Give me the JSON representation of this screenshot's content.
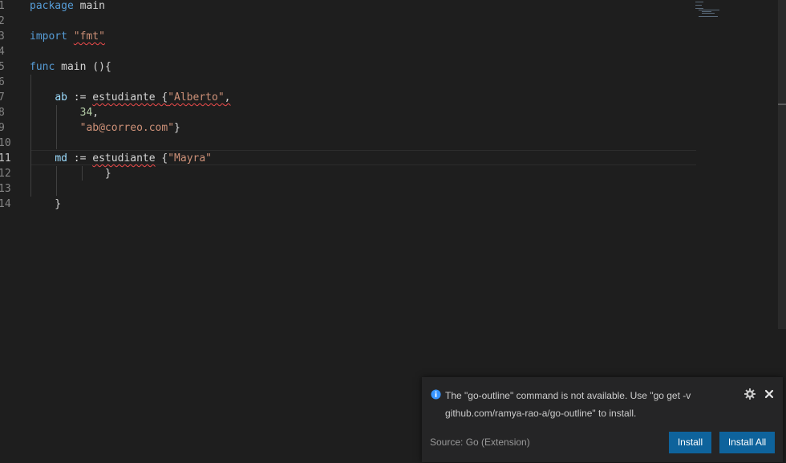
{
  "editor": {
    "line_numbers": [
      "1",
      "2",
      "3",
      "4",
      "5",
      "6",
      "7",
      "8",
      "9",
      "10",
      "11",
      "12",
      "13",
      "14"
    ],
    "current_line": "11",
    "lines": [
      [
        {
          "t": "package",
          "c": "kw"
        },
        {
          "t": " main",
          "c": "pl"
        }
      ],
      [],
      [
        {
          "t": "import",
          "c": "kw"
        },
        {
          "t": " ",
          "c": "pl"
        },
        {
          "t": "\"fmt\"",
          "c": "str",
          "err": true
        }
      ],
      [],
      [
        {
          "t": "func",
          "c": "kw"
        },
        {
          "t": " main ()",
          "c": "pl"
        },
        {
          "t": "{",
          "c": "pl"
        }
      ],
      [],
      [
        {
          "t": "    ",
          "c": "pl"
        },
        {
          "t": "ab",
          "c": "id"
        },
        {
          "t": " := ",
          "c": "pl"
        },
        {
          "t": "estudiante {",
          "c": "pl",
          "err": true
        },
        {
          "t": "\"Alberto\"",
          "c": "str",
          "err": true
        },
        {
          "t": ",",
          "c": "pl",
          "err": true
        }
      ],
      [
        {
          "t": "        ",
          "c": "pl"
        },
        {
          "t": "34",
          "c": "num"
        },
        {
          "t": ",",
          "c": "pl"
        }
      ],
      [
        {
          "t": "        ",
          "c": "pl"
        },
        {
          "t": "\"ab@correo.com\"",
          "c": "str"
        },
        {
          "t": "}",
          "c": "pl"
        }
      ],
      [],
      [
        {
          "t": "    ",
          "c": "pl"
        },
        {
          "t": "md",
          "c": "id"
        },
        {
          "t": " := ",
          "c": "pl"
        },
        {
          "t": "estudiante",
          "c": "pl",
          "err": true
        },
        {
          "t": " {",
          "c": "pl"
        },
        {
          "t": "\"Mayra\"",
          "c": "str"
        }
      ],
      [
        {
          "t": "            }",
          "c": "pl"
        }
      ],
      [],
      [
        {
          "t": "    }",
          "c": "pl"
        }
      ]
    ]
  },
  "notification": {
    "icon": "info-icon",
    "message": "The \"go-outline\" command is not available. Use \"go get -v github.com/ramya-rao-a/go-outline\" to install.",
    "source": "Source: Go (Extension)",
    "install_label": "Install",
    "install_all_label": "Install All",
    "settings_icon": "gear-icon",
    "close_icon": "close-icon"
  },
  "colors": {
    "background": "#1e1e1e",
    "keyword": "#569cd6",
    "string": "#ce9178",
    "number": "#b5cea8",
    "identifier": "#9cdcfe",
    "error_squiggle": "#f14c4c",
    "button": "#0e639c",
    "info": "#3794ff"
  }
}
